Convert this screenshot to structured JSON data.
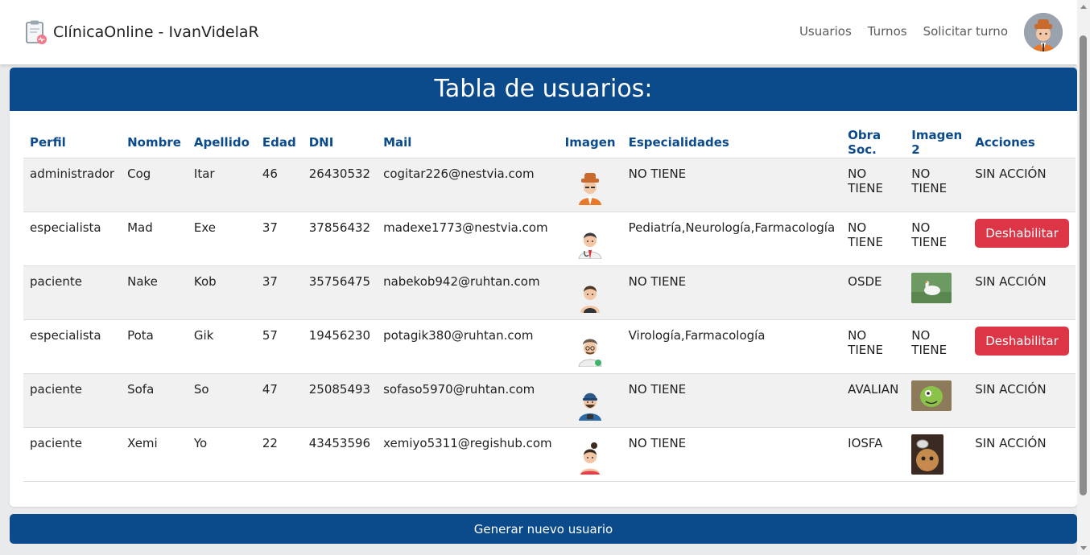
{
  "app": {
    "brand": "ClínicaOnline - IvanVidelaR",
    "nav": [
      "Usuarios",
      "Turnos",
      "Solicitar turno"
    ]
  },
  "card": {
    "title": "Tabla de usuarios:"
  },
  "table": {
    "headers": [
      "Perfil",
      "Nombre",
      "Apellido",
      "Edad",
      "DNI",
      "Mail",
      "Imagen",
      "Especialidades",
      "Obra Soc.",
      "Imagen 2",
      "Acciones"
    ],
    "rows": [
      {
        "perfil": "administrador",
        "nombre": "Cog",
        "apellido": "Itar",
        "edad": "46",
        "dni": "26430532",
        "mail": "cogitar226@nestvia.com",
        "especialidades": "NO TIENE",
        "obra": "NO TIENE",
        "imagen2": "NO TIENE",
        "accion": "SIN ACCIÓN",
        "avatar": "orange-hat-man"
      },
      {
        "perfil": "especialista",
        "nombre": "Mad",
        "apellido": "Exe",
        "edad": "37",
        "dni": "37856432",
        "mail": "madexe1773@nestvia.com",
        "especialidades": "Pediatría,Neurología,Farmacología",
        "obra": "NO TIENE",
        "imagen2": "NO TIENE",
        "accion": "Deshabilitar",
        "avatar": "doctor"
      },
      {
        "perfil": "paciente",
        "nombre": "Nake",
        "apellido": "Kob",
        "edad": "37",
        "dni": "35756475",
        "mail": "nabekob942@ruhtan.com",
        "especialidades": "NO TIENE",
        "obra": "OSDE",
        "imagen2": "goose-photo",
        "accion": "SIN ACCIÓN",
        "avatar": "tanktop-man"
      },
      {
        "perfil": "especialista",
        "nombre": "Pota",
        "apellido": "Gik",
        "edad": "57",
        "dni": "19456230",
        "mail": "potagik380@ruhtan.com",
        "especialidades": "Virología,Farmacología",
        "obra": "NO TIENE",
        "imagen2": "NO TIENE",
        "accion": "Deshabilitar",
        "avatar": "scientist"
      },
      {
        "perfil": "paciente",
        "nombre": "Sofa",
        "apellido": "So",
        "edad": "47",
        "dni": "25085493",
        "mail": "sofaso5970@ruhtan.com",
        "especialidades": "NO TIENE",
        "obra": "AVALIAN",
        "imagen2": "green-creature-photo",
        "accion": "SIN ACCIÓN",
        "avatar": "cap-man"
      },
      {
        "perfil": "paciente",
        "nombre": "Xemi",
        "apellido": "Yo",
        "edad": "22",
        "dni": "43453596",
        "mail": "xemiyo5311@regishub.com",
        "especialidades": "NO TIENE",
        "obra": "IOSFA",
        "imagen2": "cat-photo",
        "accion": "SIN ACCIÓN",
        "avatar": "woman-bun"
      }
    ]
  },
  "footer_button": "Generar nuevo usuario",
  "colors": {
    "primary": "#0b4a8b",
    "danger": "#dc3545",
    "row_alt": "#f1f1f1"
  }
}
